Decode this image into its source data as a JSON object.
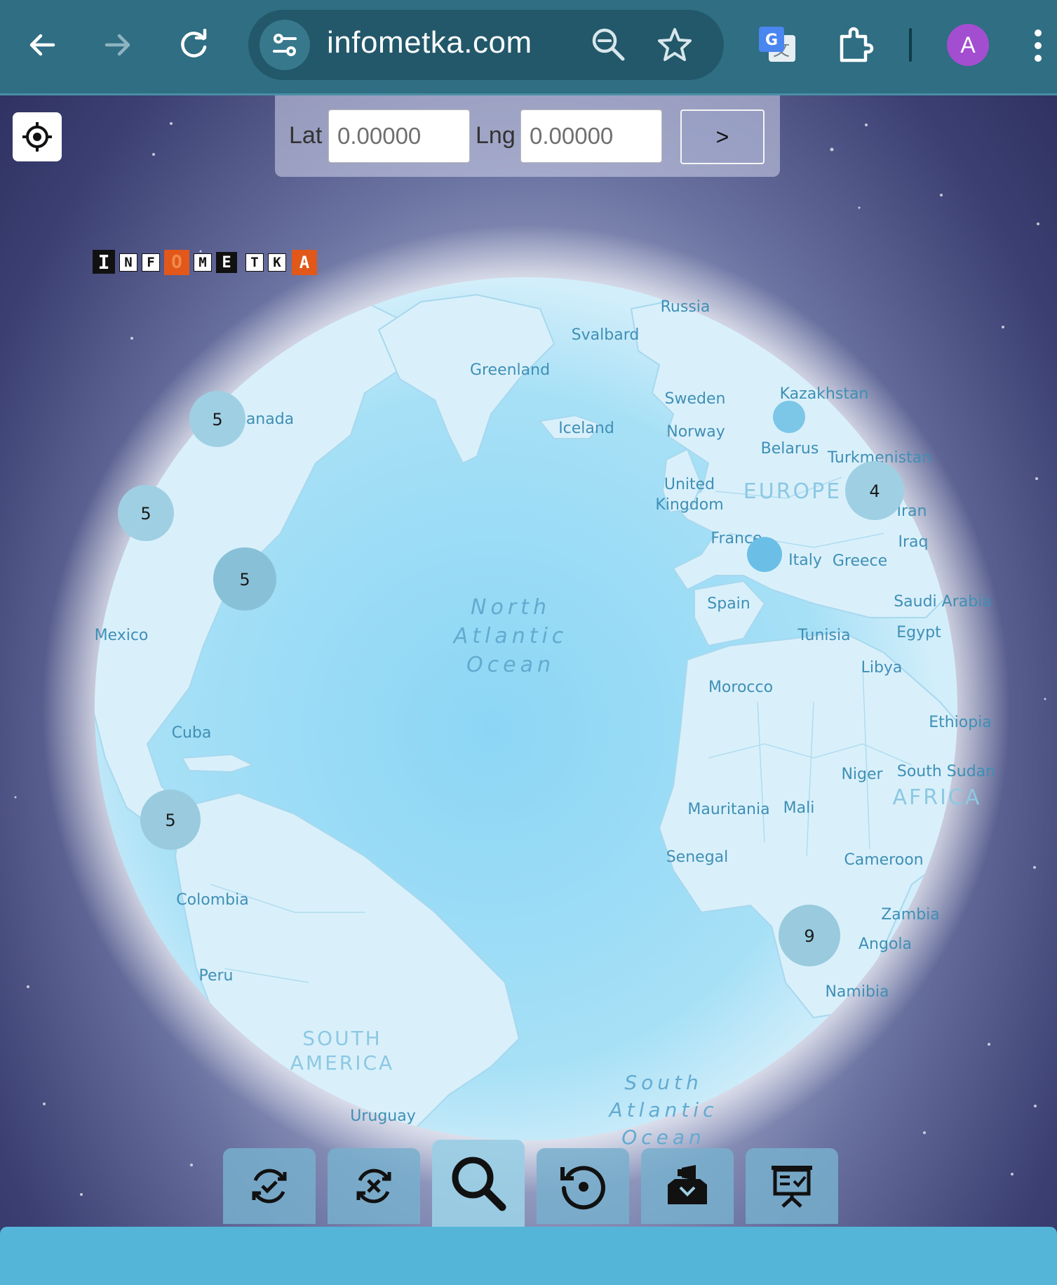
{
  "browser": {
    "url": "infometka.com",
    "avatar_letter": "A",
    "accent_color": "#2f6e83"
  },
  "coords": {
    "lat_label": "Lat",
    "lat_placeholder": "0.00000",
    "lng_label": "Lng",
    "lng_placeholder": "0.00000",
    "go_label": ">"
  },
  "logo": {
    "letters": [
      "I",
      "N",
      "F",
      "O",
      "M",
      "E",
      "T",
      "K",
      "A"
    ]
  },
  "map": {
    "labels": {
      "russia": "Russia",
      "svalbard": "Svalbard",
      "greenland": "Greenland",
      "kazakhstan": "Kazakhstan",
      "sweden": "Sweden",
      "iceland": "Iceland",
      "norway": "Norway",
      "canada": "anada",
      "belarus": "Belarus",
      "turkmenistan": "Turkmenistan",
      "united": "United",
      "kingdom": "Kingdom",
      "europe": "EUROPE",
      "iran": "Iran",
      "france": "France",
      "iraq": "Iraq",
      "italy": "Italy",
      "greece": "Greece",
      "spain": "Spain",
      "north": "North",
      "atlantic": "Atlantic",
      "ocean": "Ocean",
      "saudi": "Saudi Arabia",
      "mexico": "Mexico",
      "tunisia": "Tunisia",
      "egypt": "Egypt",
      "libya": "Libya",
      "morocco": "Morocco",
      "ethiopia": "Ethiopia",
      "cuba": "Cuba",
      "niger": "Niger",
      "southsudan": "South Sudan",
      "africa": "AFRICA",
      "mauritania": "Mauritania",
      "mali": "Mali",
      "senegal": "Senegal",
      "cameroon": "Cameroon",
      "colombia": "Colombia",
      "zambia": "Zambia",
      "angola": "Angola",
      "peru": "Peru",
      "namibia": "Namibia",
      "south_am_1": "SOUTH",
      "south_am_2": "AMERICA",
      "south": "South",
      "atlantic2": "Atlantic",
      "ocean2": "Ocean",
      "uruguay": "Uruguay"
    },
    "clusters": [
      {
        "name": "cluster-canada",
        "count": "5"
      },
      {
        "name": "cluster-west-coast",
        "count": "5"
      },
      {
        "name": "cluster-east-coast",
        "count": "5"
      },
      {
        "name": "cluster-central-america",
        "count": "5"
      },
      {
        "name": "cluster-middle-east",
        "count": "4"
      },
      {
        "name": "cluster-southern-africa",
        "count": "9"
      }
    ]
  },
  "toolbar": {
    "items": [
      "refresh-check-icon",
      "refresh-cancel-icon",
      "search-icon",
      "reset-icon",
      "inbox-announcement-icon",
      "presentation-icon"
    ]
  }
}
